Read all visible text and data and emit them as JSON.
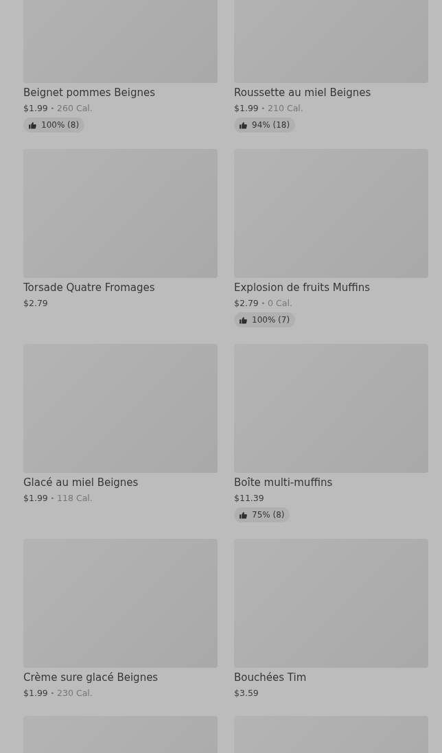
{
  "items": [
    {
      "kind": "product",
      "name": "Beignet pommes Beignes",
      "price": "$1.99",
      "separator": "•",
      "calories": "260 Cal.",
      "rating": "100% (8)"
    },
    {
      "kind": "product",
      "name": "Roussette au miel Beignes",
      "price": "$1.99",
      "separator": "•",
      "calories": "210 Cal.",
      "rating": "94% (18)"
    },
    {
      "kind": "product",
      "name": "Torsade Quatre Fromages",
      "price": "$2.79"
    },
    {
      "kind": "product",
      "name": "Explosion de fruits Muffins",
      "price": "$2.79",
      "separator": "•",
      "calories": "0 Cal.",
      "rating": "100% (7)"
    },
    {
      "kind": "product",
      "name": "Glacé au miel Beignes",
      "price": "$1.99",
      "separator": "•",
      "calories": "118 Cal."
    },
    {
      "kind": "product",
      "name": "Boîte multi-muffins",
      "price": "$11.39",
      "rating": "75% (8)"
    },
    {
      "kind": "product",
      "name": "Crème sure glacé Beignes",
      "price": "$1.99",
      "separator": "•",
      "calories": "230 Cal."
    },
    {
      "kind": "product",
      "name": "Bouchées Tim",
      "price": "$3.59"
    },
    {
      "kind": "image-only"
    },
    {
      "kind": "image-only"
    }
  ]
}
